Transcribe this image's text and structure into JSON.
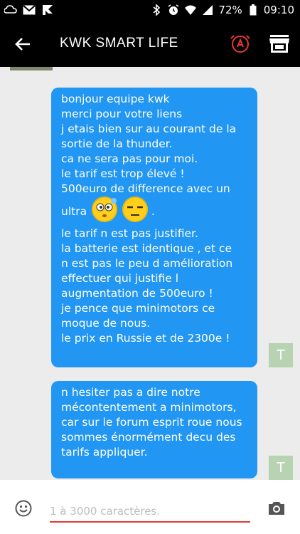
{
  "status_bar": {
    "battery": "72%",
    "time": "09:10"
  },
  "app_bar": {
    "title": "KWK SMART LIFE",
    "accent_color": "#e53935"
  },
  "messages": [
    {
      "lines": [
        "bonjour equipe kwk",
        "merci pour votre liens",
        "j etais bien sur au courant de la",
        "sortie de la thunder.",
        "ca ne sera pas pour moi.",
        "le tarif est trop élevé !",
        "500euro de difference avec un",
        "ultra",
        "le tarif n est pas justifier.",
        "la batterie est identique , et ce",
        "n est pas le peu d amélioration",
        "effectuer qui justifie l",
        "augmentation de 500euro !",
        "je pence que minimotors ce",
        "moque de nous.",
        "le prix en Russie et de 2300e !"
      ],
      "emoji_after_line": "ultra",
      "emojis": [
        "thinking-face-icon",
        "unamused-face-icon"
      ],
      "emoji_tail": ".",
      "avatar": "T"
    },
    {
      "lines": [
        "n hesiter pas a dire notre",
        "mécontentement a minimotors,",
        "car sur le forum esprit roue  nous",
        "sommes énormément decu des",
        "tarifs appliquer."
      ],
      "avatar": "T"
    }
  ],
  "input": {
    "placeholder": "1 à 3000 caractères."
  },
  "colors": {
    "bubble": "#2196f3",
    "avatar_bg": "#b8d3b1",
    "background": "#ececec"
  }
}
